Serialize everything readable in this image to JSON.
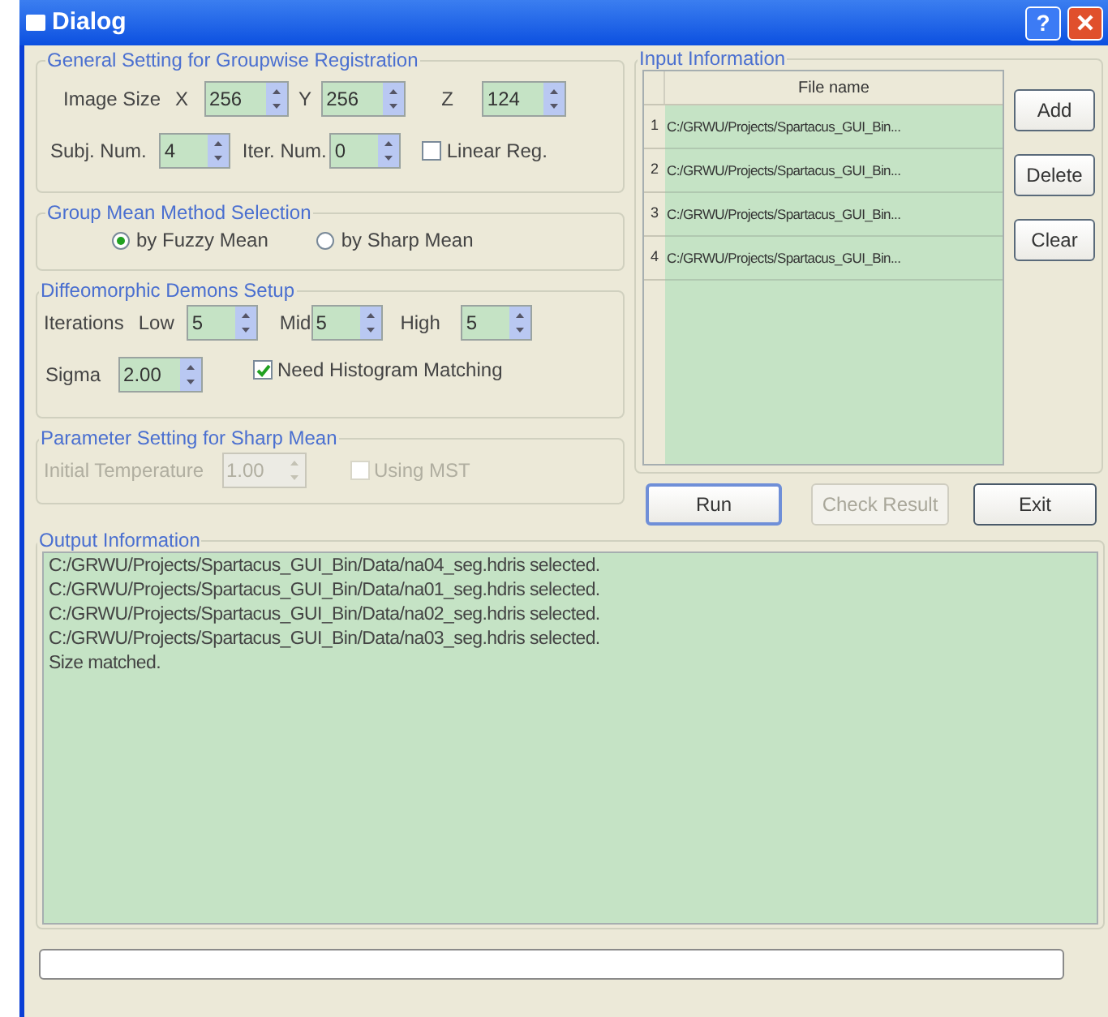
{
  "window": {
    "title": "Dialog",
    "help_button": "?"
  },
  "general": {
    "title": "General Setting for Groupwise Registration",
    "image_size_label": "Image Size",
    "dims": [
      {
        "label": "X",
        "value": "256"
      },
      {
        "label": "Y",
        "value": "256"
      },
      {
        "label": "Z",
        "value": "124"
      }
    ],
    "subj": {
      "label": "Subj. Num.",
      "value": "4"
    },
    "iter": {
      "label": "Iter. Num.",
      "value": "0"
    },
    "linear_reg": {
      "label": "Linear Reg.",
      "checked": false
    }
  },
  "group_mean": {
    "title": "Group Mean Method Selection",
    "options": [
      {
        "label": "by Fuzzy Mean",
        "selected": true
      },
      {
        "label": "by Sharp Mean",
        "selected": false
      }
    ]
  },
  "demons": {
    "title": "Diffeomorphic Demons Setup",
    "iterations_label": "Iterations",
    "levels": [
      {
        "label": "Low",
        "value": "5"
      },
      {
        "label": "Mid",
        "value": "5"
      },
      {
        "label": "High",
        "value": "5"
      }
    ],
    "sigma": {
      "label": "Sigma",
      "value": "2.00"
    },
    "histogram": {
      "label": "Need Histogram Matching",
      "checked": true
    }
  },
  "sharp": {
    "title": "Parameter Setting for Sharp Mean",
    "disabled": true,
    "temperature": {
      "label": "Initial Temperature",
      "value": "1.00"
    },
    "mst": {
      "label": "Using MST",
      "checked": false
    }
  },
  "input": {
    "title": "Input Information",
    "column": "File name",
    "rows": [
      {
        "index": "1",
        "file": "C:/GRWU/Projects/Spartacus_GUI_Bin..."
      },
      {
        "index": "2",
        "file": "C:/GRWU/Projects/Spartacus_GUI_Bin..."
      },
      {
        "index": "3",
        "file": "C:/GRWU/Projects/Spartacus_GUI_Bin..."
      },
      {
        "index": "4",
        "file": "C:/GRWU/Projects/Spartacus_GUI_Bin..."
      }
    ],
    "buttons": [
      "Add",
      "Delete",
      "Clear"
    ]
  },
  "actions": [
    {
      "label": "Run",
      "disabled": false,
      "default": true
    },
    {
      "label": "Check Result",
      "disabled": true,
      "default": false
    },
    {
      "label": "Exit",
      "disabled": false,
      "default": false
    }
  ],
  "output": {
    "title": "Output Information",
    "lines": [
      "C:/GRWU/Projects/Spartacus_GUI_Bin/Data/na04_seg.hdris selected.",
      "C:/GRWU/Projects/Spartacus_GUI_Bin/Data/na01_seg.hdris selected.",
      "C:/GRWU/Projects/Spartacus_GUI_Bin/Data/na02_seg.hdris selected.",
      "C:/GRWU/Projects/Spartacus_GUI_Bin/Data/na03_seg.hdris selected.",
      "Size matched."
    ]
  }
}
